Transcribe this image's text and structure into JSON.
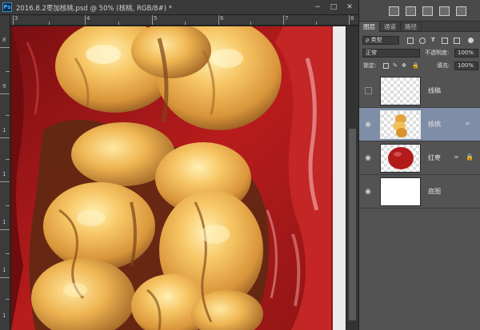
{
  "document": {
    "title": "2016.8.2枣加核桃.psd @ 50% (核桃, RGB/8#) *",
    "app_icon": "Ps",
    "controls": [
      "−",
      "□",
      "✕"
    ],
    "ruler_top_numbers": [
      "3",
      "4",
      "5",
      "6",
      "7",
      "8"
    ],
    "ruler_left_numbers": [
      "8",
      "9",
      "1",
      "1",
      "1",
      "1",
      "1"
    ]
  },
  "panels": {
    "tabs": [
      "图层",
      "通道",
      "路径"
    ],
    "active_tab": "图层",
    "filter": {
      "kind_label": "ρ 类型"
    },
    "blend_mode": "正常",
    "opacity_label": "不透明度:",
    "opacity_value": "100%",
    "lock_label": "锁定:",
    "fill_label": "填充:",
    "fill_value": "100%",
    "layers": [
      {
        "name": "线稿",
        "visible": false,
        "selected": false,
        "thumb": "transparent",
        "linked": false
      },
      {
        "name": "核桃",
        "visible": true,
        "selected": true,
        "thumb": "walnut",
        "linked": true
      },
      {
        "name": "红枣",
        "visible": true,
        "selected": false,
        "thumb": "jujube",
        "linked": true
      },
      {
        "name": "底图",
        "visible": true,
        "selected": false,
        "thumb": "white",
        "linked": false
      }
    ]
  },
  "icons": {
    "eye": "eye-icon",
    "link": "link-icon",
    "lock": "lock-icon"
  }
}
